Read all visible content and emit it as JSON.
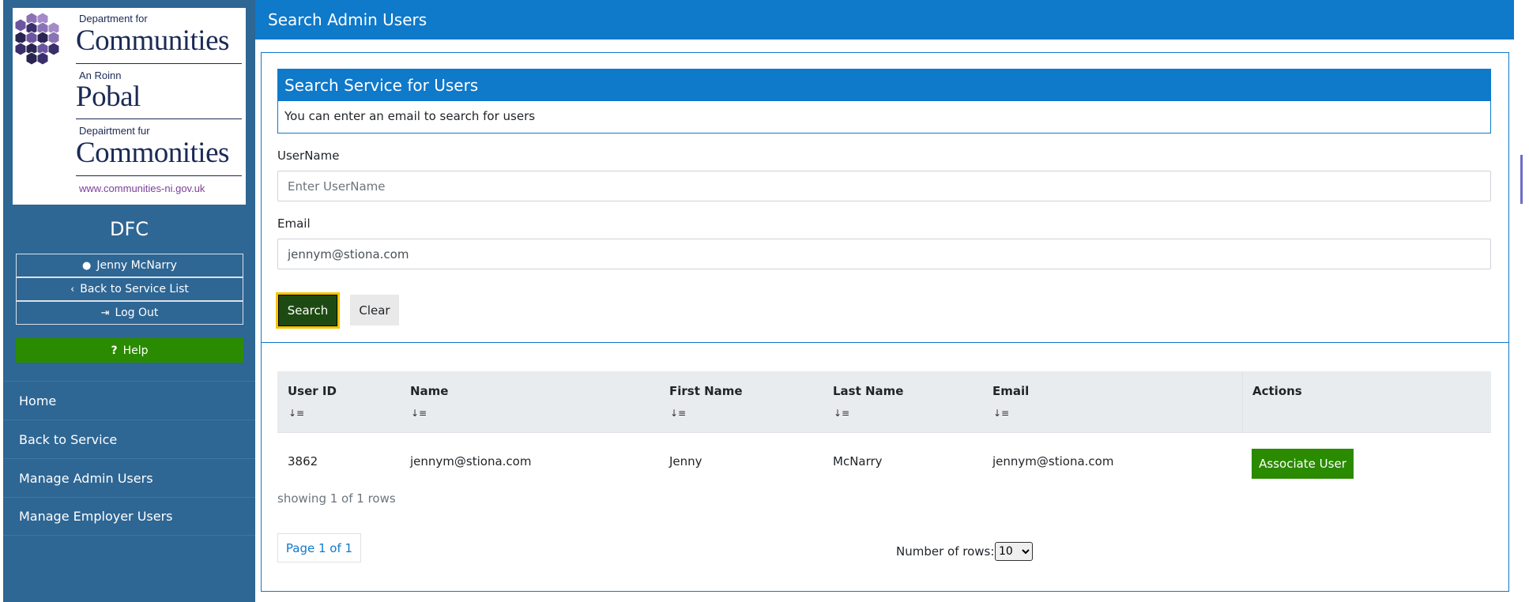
{
  "logo": {
    "dept_for": "Department for",
    "communities": "Communities",
    "an_roinn": "An Roinn",
    "pobal": "Pobal",
    "depairtment_fur": "Depairtment fur",
    "commonities": "Commonities",
    "url": "www.communities-ni.gov.uk"
  },
  "sidebar": {
    "org_name": "DFC",
    "user_name": "Jenny McNarry",
    "back_to_list": "Back to Service List",
    "log_out": "Log Out",
    "help": "Help",
    "nav": [
      "Home",
      "Back to Service",
      "Manage Admin Users",
      "Manage Employer Users"
    ]
  },
  "header": {
    "title": "Search Admin Users"
  },
  "search": {
    "panel_title": "Search Service for Users",
    "panel_desc": "You can enter an email to search for users",
    "username_label": "UserName",
    "username_placeholder": "Enter UserName",
    "username_value": "",
    "email_label": "Email",
    "email_value": "jennym@stiona.com",
    "search_button": "Search",
    "clear_button": "Clear"
  },
  "table": {
    "columns": [
      "User ID",
      "Name",
      "First Name",
      "Last Name",
      "Email",
      "Actions"
    ],
    "rows": [
      {
        "user_id": "3862",
        "name": "jennym@stiona.com",
        "first_name": "Jenny",
        "last_name": "McNarry",
        "email": "jennym@stiona.com",
        "action": "Associate User"
      }
    ],
    "rows_info": "showing 1 of 1 rows",
    "page_info": "Page 1 of 1",
    "rows_per_page_label": "Number of rows:",
    "rows_per_page": "10"
  },
  "colors": {
    "sidebar": "#2e6694",
    "header": "#0f79ca",
    "help": "#2a8a00",
    "search_button": "#1d4a12",
    "focus_outline": "#f5c400"
  }
}
